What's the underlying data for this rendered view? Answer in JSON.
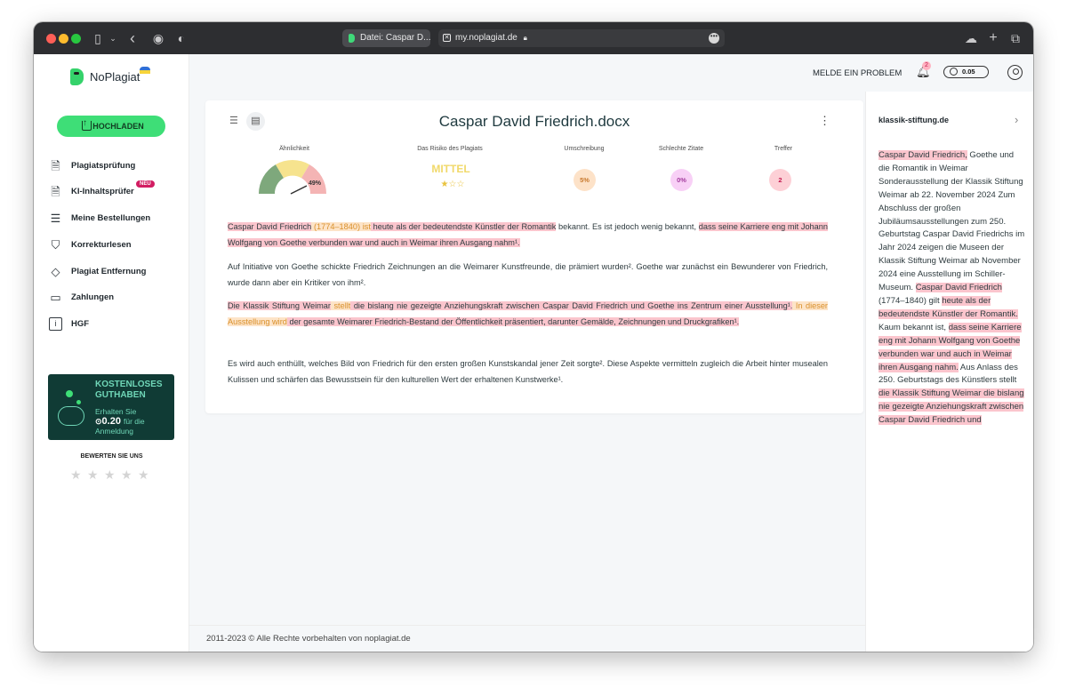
{
  "browser": {
    "tab_title": "Datei: Caspar D...",
    "url": "my.noplagiat.de"
  },
  "sidebar": {
    "logo_text": "NoPlagiat",
    "upload_label": "HOCHLADEN",
    "items": [
      {
        "label": "Plagiatsprüfung",
        "icon": "document-check-icon"
      },
      {
        "label": "KI-Inhaltsprüfer",
        "icon": "document-ai-icon",
        "badge": "NEU"
      },
      {
        "label": "Meine Bestellungen",
        "icon": "list-icon"
      },
      {
        "label": "Korrekturlesen",
        "icon": "cart-icon"
      },
      {
        "label": "Plagiat Entfernung",
        "icon": "eraser-icon"
      },
      {
        "label": "Zahlungen",
        "icon": "payment-icon"
      },
      {
        "label": "HGF",
        "icon": "info-icon"
      }
    ],
    "credit_box": {
      "title": "KOSTENLOSES GUTHABEN",
      "line1": "Erhalten Sie",
      "amount": "0.20",
      "unit": "für die",
      "line2": "Anmeldung"
    },
    "rate_title": "BEWERTEN SIE UNS",
    "rating_stars": 5
  },
  "header": {
    "report_label": "MELDE EIN PROBLEM",
    "notifications_count": "2",
    "credit_balance": "0.05"
  },
  "document": {
    "title": "Caspar David Friedrich.docx",
    "metrics": {
      "similarity_label": "Ähnlichkeit",
      "similarity_value": "49%",
      "similarity_fraction": 0.49,
      "risk_label": "Das Risiko des Plagiats",
      "risk_value": "MITTEL",
      "risk_stars": 1,
      "risk_stars_total": 3,
      "rewrite_label": "Umschreibung",
      "rewrite_value": "5%",
      "bad_quotes_label": "Schlechte Zitate",
      "bad_quotes_value": "0%",
      "hits_label": "Treffer",
      "hits_value": "2"
    },
    "paragraphs": {
      "p1": {
        "s1": "Caspar David Friedrich",
        "s2": " (1774–1840) ist",
        "s3": " heute als der bedeutendste Künstler der Romantik",
        "s4": " bekannt. Es ist jedoch wenig bekannt, ",
        "s5": "dass seine Karriere eng mit Johann Wolfgang von Goethe verbunden war und auch in Weimar ihren Ausgang nahm¹."
      },
      "p2": "Auf Initiative von Goethe schickte Friedrich Zeichnungen an die Weimarer Kunstfreunde, die prämiert wurden². Goethe war zunächst ein Bewunderer von Friedrich, wurde dann aber ein Kritiker von ihm².",
      "p3": {
        "s1": "Die Klassik Stiftung Weimar",
        "s2": " stellt",
        "s3": " die bislang nie gezeigte Anziehungskraft zwischen Caspar David Friedrich und Goethe ins Zentrum einer Ausstellung¹.",
        "s4": " In dieser Ausstellung wird",
        "s5": " der gesamte Weimarer Friedrich-Bestand der Öffentlichkeit präsentiert, darunter Gemälde, Zeichnungen und Druckgrafiken¹."
      },
      "p4": "Es wird auch enthüllt, welches Bild von Friedrich für den ersten großen Kunstskandal jener Zeit sorgte². Diese Aspekte vermitteln zugleich die Arbeit hinter musealen Kulissen und schärfen das Bewusstsein für den kulturellen Wert der erhaltenen Kunstwerke¹."
    }
  },
  "source_panel": {
    "source": "klassik-stiftung.de",
    "text": {
      "t1": "Caspar David Friedrich,",
      "t2": " Goethe und die Romantik in Weimar Sonderausstellung der Klassik Stiftung Weimar ab 22. November 2024 Zum Abschluss der großen Jubiläumsausstellungen zum 250. Geburtstag Caspar David Friedrichs im Jahr 2024 zeigen die Museen der Klassik Stiftung Weimar ab November 2024 eine Ausstellung im Schiller-Museum. ",
      "t3": "Caspar David Friedrich",
      "t4": " (1774–1840) gilt ",
      "t5": "heute als der bedeutendste Künstler der Romantik.",
      "t6": " Kaum bekannt ist, ",
      "t7": "dass seine Karriere eng mit Johann Wolfgang von Goethe verbunden war und auch in Weimar ihren Ausgang nahm.",
      "t8": " Aus Anlass des 250. Geburtstags des Künstlers stellt ",
      "t9": "die Klassik Stiftung Weimar die bislang nie gezeigte Anziehungskraft zwischen Caspar David Friedrich und"
    }
  },
  "footer": {
    "copyright": "2011-2023 © Alle Rechte vorbehalten von noplagiat.de"
  },
  "colors": {
    "accent_green": "#3ede77",
    "match_red": "#fbc5cd",
    "rewrite_orange": "#fde4c8",
    "credit_box_bg": "#103b35"
  }
}
